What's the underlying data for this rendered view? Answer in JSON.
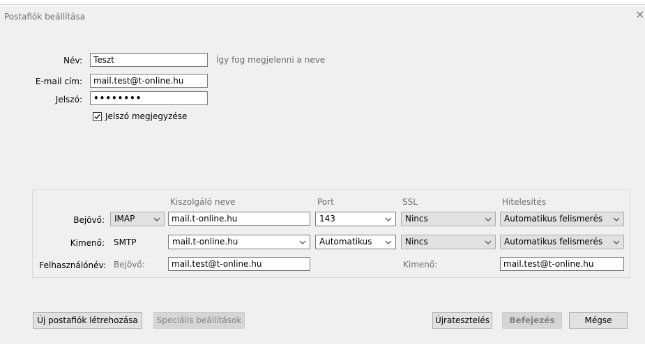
{
  "window": {
    "title": "Postafiók beállítása",
    "close_glyph": "×"
  },
  "account": {
    "name_label": "Név:",
    "name_value": "Teszt",
    "name_hint": "Így fog megjelenni a neve",
    "email_label": "E-mail cím:",
    "email_value": "mail.test@t-online.hu",
    "password_label": "Jelszó:",
    "password_value": "••••••••",
    "remember_label": "Jelszó megjegyzése",
    "remember_checked": true
  },
  "server": {
    "columns": {
      "hostname": "Kiszolgáló neve",
      "port": "Port",
      "ssl": "SSL",
      "auth": "Hitelesítés"
    },
    "incoming": {
      "label": "Bejövő:",
      "protocol": "IMAP",
      "hostname": "mail.t-online.hu",
      "port": "143",
      "ssl": "Nincs",
      "auth": "Automatikus felismerés"
    },
    "outgoing": {
      "label": "Kimenő:",
      "protocol": "SMTP",
      "hostname": "mail.t-online.hu",
      "port": "Automatikus",
      "ssl": "Nincs",
      "auth": "Automatikus felismerés"
    },
    "username": {
      "label": "Felhasználónév:",
      "incoming_label": "Bejövő:",
      "incoming_value": "mail.test@t-online.hu",
      "outgoing_label": "Kimenő:",
      "outgoing_value": "mail.test@t-online.hu"
    }
  },
  "buttons": {
    "new_account": "Új postafiók létrehozása",
    "advanced": "Speciális beállítások",
    "retest": "Újratesztelés",
    "done": "Befejezés",
    "cancel": "Mégse"
  }
}
